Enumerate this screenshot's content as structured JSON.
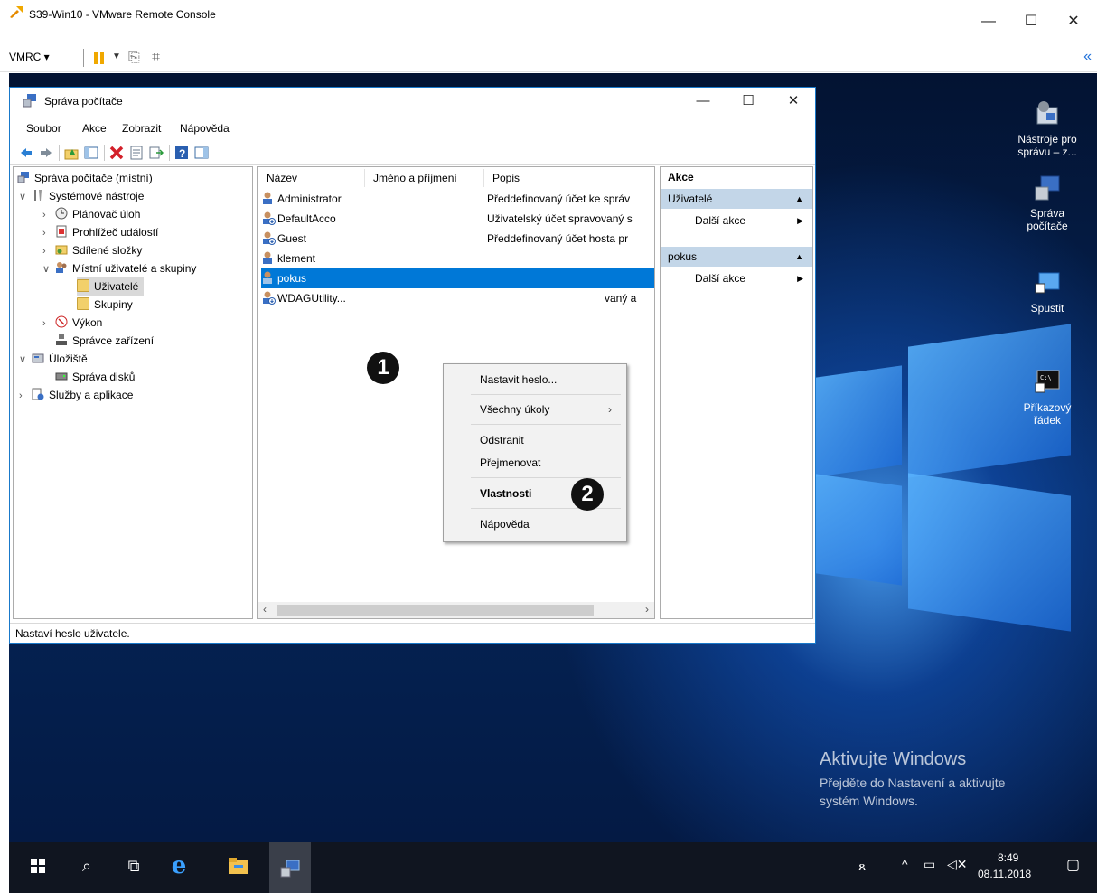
{
  "vmrc": {
    "title": "S39-Win10 - VMware Remote Console",
    "menu_label": "VMRC ▾",
    "window_controls": {
      "minimize": "—",
      "maximize": "☐",
      "close": "✕"
    }
  },
  "mmc": {
    "title": "Správa počítače",
    "window_controls": {
      "minimize": "—",
      "maximize": "☐",
      "close": "✕"
    },
    "menus": [
      "Soubor",
      "Akce",
      "Zobrazit",
      "Nápověda"
    ],
    "tree": {
      "root": "Správa počítače (místní)",
      "system_tools": "Systémové nástroje",
      "task_scheduler": "Plánovač úloh",
      "event_viewer": "Prohlížeč událostí",
      "shared_folders": "Sdílené složky",
      "local_users": "Místní uživatelé a skupiny",
      "users": "Uživatelé",
      "groups": "Skupiny",
      "performance": "Výkon",
      "device_manager": "Správce zařízení",
      "storage": "Úložiště",
      "disk_management": "Správa disků",
      "services_apps": "Služby a aplikace"
    },
    "list": {
      "columns": [
        "Název",
        "Jméno a příjmení",
        "Popis"
      ],
      "rows": [
        {
          "name": "Administrator",
          "description": "Předdefinovaný účet ke správ"
        },
        {
          "name": "DefaultAcco",
          "description": "Uživatelský účet spravovaný s"
        },
        {
          "name": "Guest",
          "description": "Předdefinovaný účet hosta pr"
        },
        {
          "name": "klement",
          "description": ""
        },
        {
          "name": "pokus",
          "description": ""
        },
        {
          "name": "WDAGUtility...",
          "description": "vaný a"
        }
      ]
    },
    "actions": {
      "header": "Akce",
      "group1": "Uživatelé",
      "group1_item": "Další akce",
      "group2": "pokus",
      "group2_item": "Další akce"
    },
    "status": "Nastaví heslo uživatele."
  },
  "context_menu": {
    "set_password": "Nastavit heslo...",
    "all_tasks": "Všechny úkoly",
    "delete": "Odstranit",
    "rename": "Přejmenovat",
    "properties": "Vlastnosti",
    "help": "Nápověda"
  },
  "badges": {
    "one": "1",
    "two": "2"
  },
  "desktop_icons": {
    "tools": {
      "line1": "Nástroje pro",
      "line2": "správu – z..."
    },
    "compmgmt": {
      "line1": "Správa",
      "line2": "počítače"
    },
    "run": {
      "line1": "Spustit"
    },
    "cmd": {
      "line1": "Příkazový",
      "line2": "řádek"
    }
  },
  "activation": {
    "title": "Aktivujte Windows",
    "line1": "Přejděte do Nastavení a aktivujte",
    "line2": "systém Windows."
  },
  "taskbar": {
    "time": "8:49",
    "date": "08.11.2018"
  },
  "colors": {
    "selection": "#0078d7",
    "actions_group": "#c3d6e8",
    "taskbar": "#101520"
  }
}
